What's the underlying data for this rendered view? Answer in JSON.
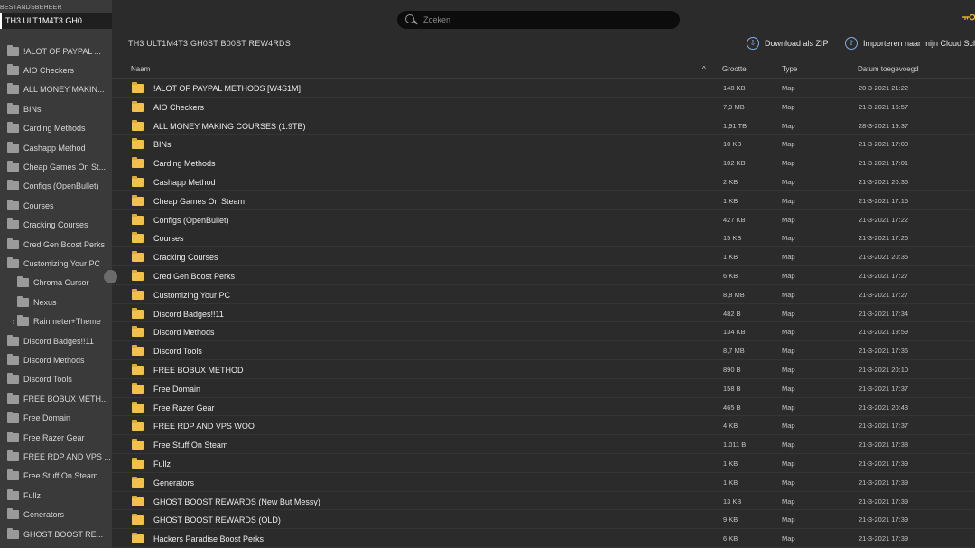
{
  "sidebar": {
    "header": "BESTANDSBEHEER",
    "root": "TH3 ULT1M4T3 GH0...",
    "items": [
      {
        "label": "!ALOT OF PAYPAL ...",
        "indent": 0,
        "chevron": ""
      },
      {
        "label": "AIO Checkers",
        "indent": 0,
        "chevron": ""
      },
      {
        "label": "ALL MONEY MAKIN...",
        "indent": 0,
        "chevron": ""
      },
      {
        "label": "BINs",
        "indent": 0,
        "chevron": ""
      },
      {
        "label": "Carding Methods",
        "indent": 0,
        "chevron": ""
      },
      {
        "label": "Cashapp Method",
        "indent": 0,
        "chevron": ""
      },
      {
        "label": "Cheap Games On St...",
        "indent": 0,
        "chevron": ""
      },
      {
        "label": "Configs (OpenBullet)",
        "indent": 0,
        "chevron": ""
      },
      {
        "label": "Courses",
        "indent": 0,
        "chevron": ""
      },
      {
        "label": "Cracking Courses",
        "indent": 0,
        "chevron": ""
      },
      {
        "label": "Cred Gen Boost Perks",
        "indent": 0,
        "chevron": ""
      },
      {
        "label": "Customizing Your PC",
        "indent": 0,
        "chevron": ""
      },
      {
        "label": "Chroma Cursor",
        "indent": 1,
        "chevron": ""
      },
      {
        "label": "Nexus",
        "indent": 1,
        "chevron": ""
      },
      {
        "label": "Rainmeter+Theme",
        "indent": 1,
        "chevron": "›"
      },
      {
        "label": "Discord Badges!!11",
        "indent": 0,
        "chevron": ""
      },
      {
        "label": "Discord Methods",
        "indent": 0,
        "chevron": ""
      },
      {
        "label": "Discord Tools",
        "indent": 0,
        "chevron": ""
      },
      {
        "label": "FREE BOBUX METH...",
        "indent": 0,
        "chevron": ""
      },
      {
        "label": "Free Domain",
        "indent": 0,
        "chevron": ""
      },
      {
        "label": "Free Razer Gear",
        "indent": 0,
        "chevron": ""
      },
      {
        "label": "FREE RDP AND VPS ...",
        "indent": 0,
        "chevron": ""
      },
      {
        "label": "Free Stuff On Steam",
        "indent": 0,
        "chevron": ""
      },
      {
        "label": "Fullz",
        "indent": 0,
        "chevron": ""
      },
      {
        "label": "Generators",
        "indent": 0,
        "chevron": ""
      },
      {
        "label": "GHOST BOOST RE...",
        "indent": 0,
        "chevron": ""
      }
    ]
  },
  "search": {
    "placeholder": "Zoeken"
  },
  "title": "TH3 ULT1M4T3 GH0ST B00ST REW4RDS",
  "actions": {
    "download_zip": "Download als ZIP",
    "import_cloud": "Importeren naar mijn Cloud Sch"
  },
  "table": {
    "headers": {
      "name": "Naam",
      "size": "Grootte",
      "type": "Type",
      "date": "Datum toegevoegd"
    },
    "sort_indicator": "^",
    "rows": [
      {
        "name": "!ALOT OF PAYPAL METHODS [W4S1M]",
        "size": "148 KB",
        "type": "Map",
        "date": "20-3-2021 21:22"
      },
      {
        "name": "AIO Checkers",
        "size": "7,9 MB",
        "type": "Map",
        "date": "21-3-2021 16:57"
      },
      {
        "name": "ALL MONEY MAKING COURSES (1.9TB)",
        "size": "1,91 TB",
        "type": "Map",
        "date": "28-3-2021 19:37"
      },
      {
        "name": "BINs",
        "size": "10 KB",
        "type": "Map",
        "date": "21-3-2021 17:00"
      },
      {
        "name": "Carding Methods",
        "size": "102 KB",
        "type": "Map",
        "date": "21-3-2021 17:01"
      },
      {
        "name": "Cashapp Method",
        "size": "2 KB",
        "type": "Map",
        "date": "21-3-2021 20:36"
      },
      {
        "name": "Cheap Games On Steam",
        "size": "1 KB",
        "type": "Map",
        "date": "21-3-2021 17:16"
      },
      {
        "name": "Configs (OpenBullet)",
        "size": "427 KB",
        "type": "Map",
        "date": "21-3-2021 17:22"
      },
      {
        "name": "Courses",
        "size": "15 KB",
        "type": "Map",
        "date": "21-3-2021 17:26"
      },
      {
        "name": "Cracking Courses",
        "size": "1 KB",
        "type": "Map",
        "date": "21-3-2021 20:35"
      },
      {
        "name": "Cred Gen Boost Perks",
        "size": "6 KB",
        "type": "Map",
        "date": "21-3-2021 17:27"
      },
      {
        "name": "Customizing Your PC",
        "size": "8,8 MB",
        "type": "Map",
        "date": "21-3-2021 17:27"
      },
      {
        "name": "Discord Badges!!11",
        "size": "482 B",
        "type": "Map",
        "date": "21-3-2021 17:34"
      },
      {
        "name": "Discord Methods",
        "size": "134 KB",
        "type": "Map",
        "date": "21-3-2021 19:59"
      },
      {
        "name": "Discord Tools",
        "size": "8,7 MB",
        "type": "Map",
        "date": "21-3-2021 17:36"
      },
      {
        "name": "FREE BOBUX METHOD",
        "size": "890 B",
        "type": "Map",
        "date": "21-3-2021 20:10"
      },
      {
        "name": "Free Domain",
        "size": "158 B",
        "type": "Map",
        "date": "21-3-2021 17:37"
      },
      {
        "name": "Free Razer Gear",
        "size": "465 B",
        "type": "Map",
        "date": "21-3-2021 20:43"
      },
      {
        "name": "FREE RDP AND VPS WOO",
        "size": "4 KB",
        "type": "Map",
        "date": "21-3-2021 17:37"
      },
      {
        "name": "Free Stuff On Steam",
        "size": "1.011 B",
        "type": "Map",
        "date": "21-3-2021 17:38"
      },
      {
        "name": "Fullz",
        "size": "1 KB",
        "type": "Map",
        "date": "21-3-2021 17:39"
      },
      {
        "name": "Generators",
        "size": "1 KB",
        "type": "Map",
        "date": "21-3-2021 17:39"
      },
      {
        "name": "GHOST BOOST REWARDS (New But Messy)",
        "size": "13 KB",
        "type": "Map",
        "date": "21-3-2021 17:39"
      },
      {
        "name": "GHOST BOOST REWARDS (OLD)",
        "size": "9 KB",
        "type": "Map",
        "date": "21-3-2021 17:39"
      },
      {
        "name": "Hackers Paradise Boost Perks",
        "size": "6 KB",
        "type": "Map",
        "date": "21-3-2021 17:39"
      }
    ]
  },
  "icons": {
    "search": "search-icon",
    "folder": "folder-icon",
    "download": "download-icon",
    "cloud": "cloud-upload-icon",
    "key": "key-icon"
  },
  "colors": {
    "folder": "#f2c14b",
    "accent": "#7fb0e8",
    "key": "#e8b923"
  }
}
